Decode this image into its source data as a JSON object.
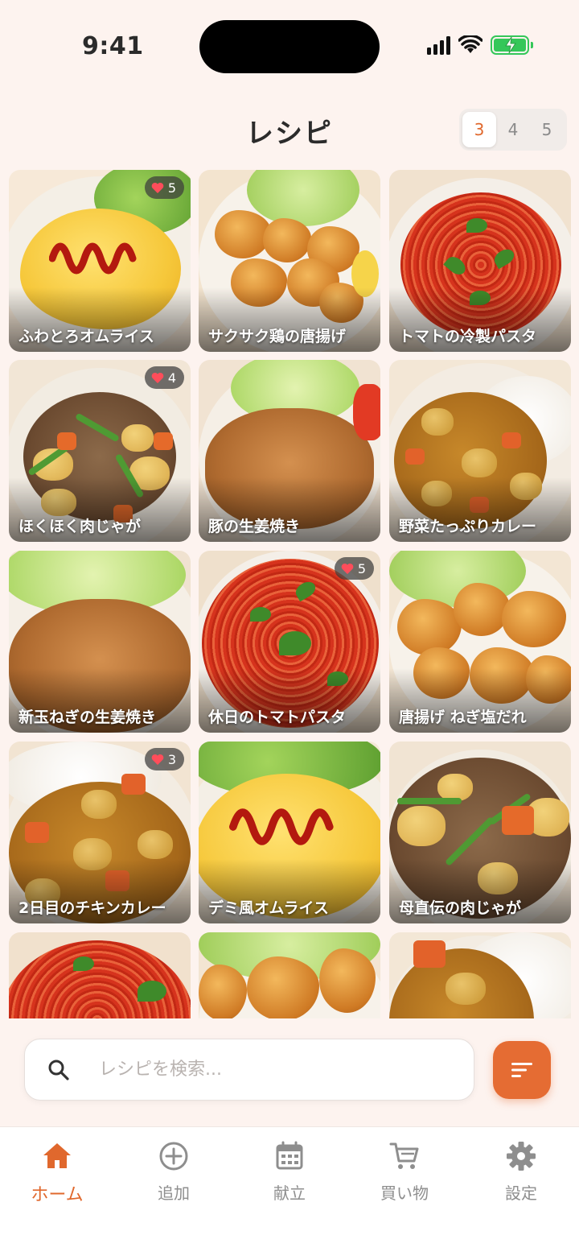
{
  "status_bar": {
    "time": "9:41"
  },
  "header": {
    "title": "レシピ",
    "column_options": [
      "3",
      "4",
      "5"
    ],
    "column_selected": "3"
  },
  "recipes": [
    {
      "name": "ふわとろオムライス",
      "likes": "5"
    },
    {
      "name": "サクサク鶏の唐揚げ",
      "likes": ""
    },
    {
      "name": "トマトの冷製パスタ",
      "likes": ""
    },
    {
      "name": "ほくほく肉じゃが",
      "likes": "4"
    },
    {
      "name": "豚の生姜焼き",
      "likes": ""
    },
    {
      "name": "野菜たっぷりカレー",
      "likes": ""
    },
    {
      "name": "新玉ねぎの生姜焼き",
      "likes": ""
    },
    {
      "name": "休日のトマトパスタ",
      "likes": "5"
    },
    {
      "name": "唐揚げ ねぎ塩だれ",
      "likes": ""
    },
    {
      "name": "2日目のチキンカレー",
      "likes": "3"
    },
    {
      "name": "デミ風オムライス",
      "likes": ""
    },
    {
      "name": "母直伝の肉じゃが",
      "likes": ""
    }
  ],
  "search": {
    "placeholder": "レシピを検索..."
  },
  "tabs": [
    {
      "label": "ホーム",
      "icon": "home-icon",
      "active": true
    },
    {
      "label": "追加",
      "icon": "plus-circle-icon",
      "active": false
    },
    {
      "label": "献立",
      "icon": "calendar-icon",
      "active": false
    },
    {
      "label": "買い物",
      "icon": "cart-icon",
      "active": false
    },
    {
      "label": "設定",
      "icon": "gear-icon",
      "active": false
    }
  ],
  "colors": {
    "accent": "#e56c33",
    "background": "#fdf3ef",
    "like_heart": "#ff4d5a"
  }
}
